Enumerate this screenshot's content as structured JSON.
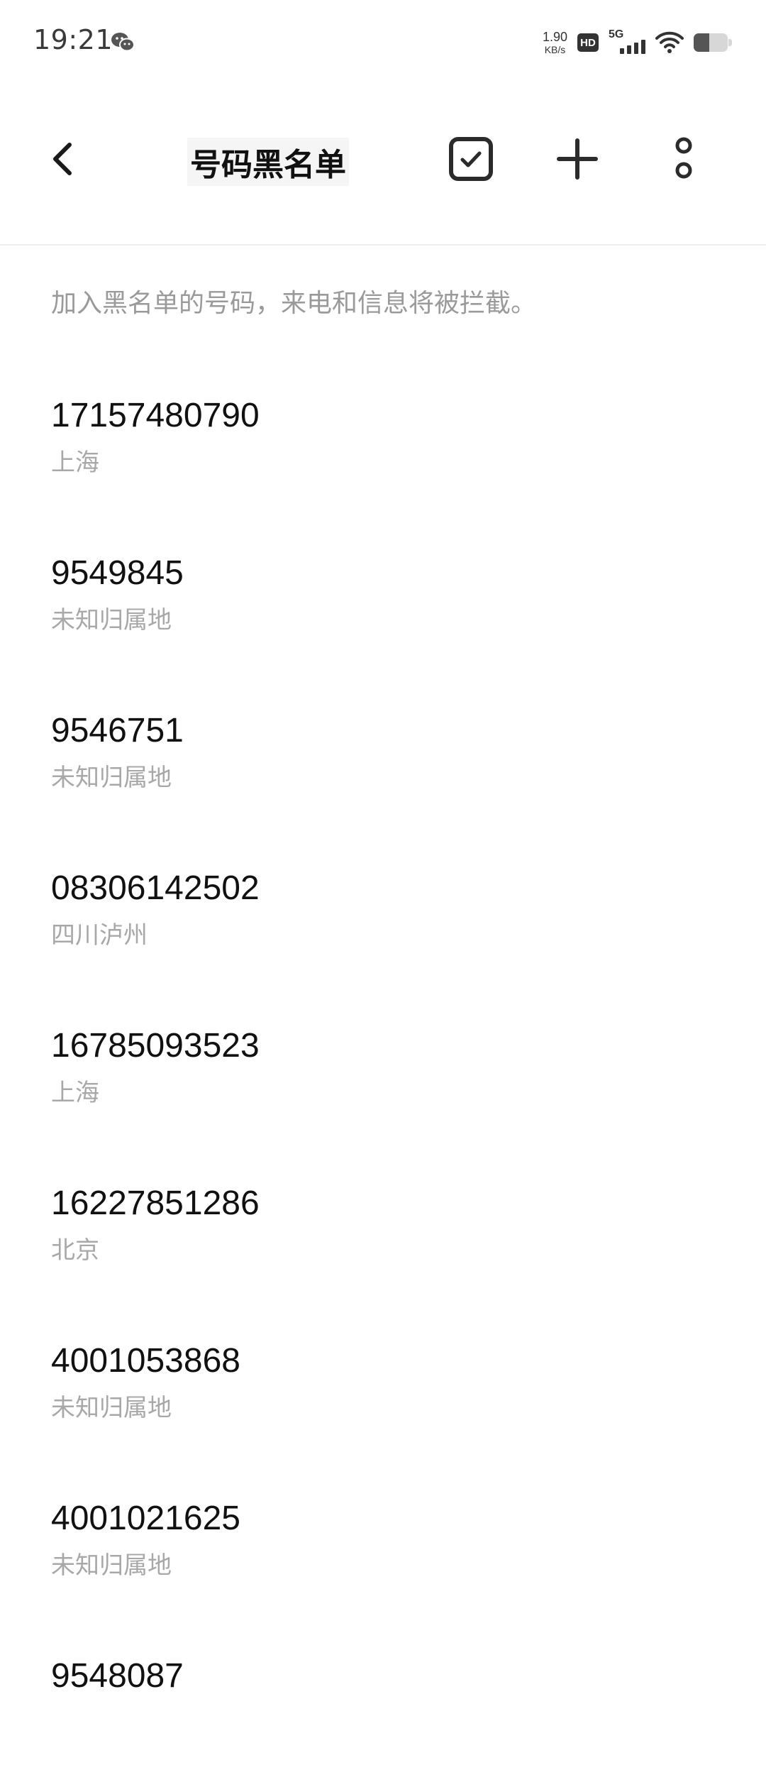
{
  "status_bar": {
    "time": "19:21",
    "net_speed_value": "1.90",
    "net_speed_unit": "KB/s",
    "hd_label": "HD",
    "network_type": "5G",
    "battery_level": 0.45
  },
  "header": {
    "title": "号码黑名单"
  },
  "hint": "加入黑名单的号码，来电和信息将被拦截。",
  "blocked_numbers": [
    {
      "number": "17157480790",
      "location": "上海"
    },
    {
      "number": "9549845",
      "location": "未知归属地"
    },
    {
      "number": "9546751",
      "location": "未知归属地"
    },
    {
      "number": "08306142502",
      "location": "四川泸州"
    },
    {
      "number": "16785093523",
      "location": "上海"
    },
    {
      "number": "16227851286",
      "location": "北京"
    },
    {
      "number": "4001053868",
      "location": "未知归属地"
    },
    {
      "number": "4001021625",
      "location": "未知归属地"
    },
    {
      "number": "9548087",
      "location": ""
    }
  ],
  "colors": {
    "text_primary": "#111111",
    "text_secondary": "#a8a8a8",
    "icon": "#2b2b2b"
  },
  "icons": {
    "back": "chevron-left-icon",
    "select": "checkbox-icon",
    "add": "plus-icon",
    "more": "more-vertical-icon"
  }
}
